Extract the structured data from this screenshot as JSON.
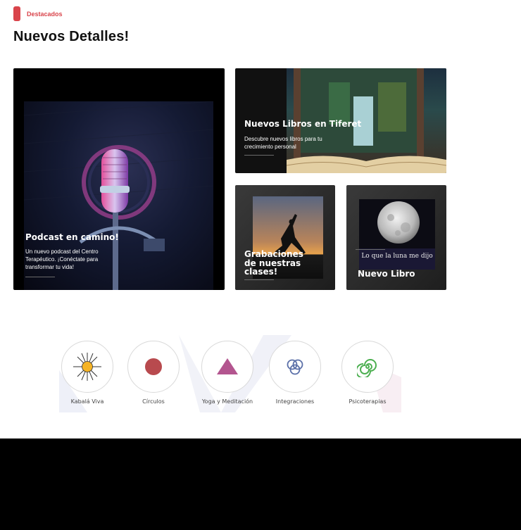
{
  "section": {
    "tag": "Destacados",
    "title": "Nuevos Detalles!"
  },
  "cards": {
    "podcast": {
      "title": "Podcast en camino!",
      "desc": "Un nuevo podcast del Centro Terapéutico. ¡Conéctate para transformar tu vida!"
    },
    "libros": {
      "title": "Nuevos Libros en Tiferet",
      "desc": "Descubre nuevos libros para tu crecimiento personal"
    },
    "grabaciones": {
      "title": "Grabaciones de nuestras clases!"
    },
    "libro": {
      "title": "Nuevo Libro",
      "cover_text": "Lo que la luna me dijo"
    }
  },
  "categories": [
    {
      "label": "Kabalá Viva",
      "icon": "sun-icon",
      "color": "#f5b324"
    },
    {
      "label": "Círculos",
      "icon": "circle-icon",
      "color": "#b84a4e"
    },
    {
      "label": "Yoga y Meditación",
      "icon": "triangle-icon",
      "color": "#b3558f"
    },
    {
      "label": "Integraciones",
      "icon": "rings-icon",
      "color": "#5a6fa8"
    },
    {
      "label": "Psicoterapias",
      "icon": "spiral-icon",
      "color": "#4caf50"
    }
  ],
  "colors": {
    "accent": "#d9444b"
  }
}
